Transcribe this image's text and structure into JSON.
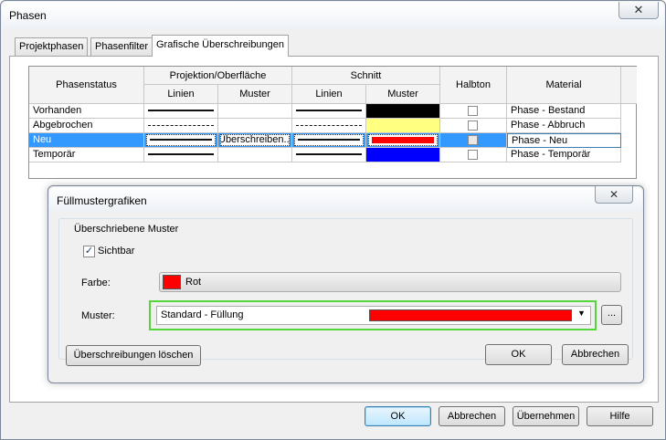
{
  "window": {
    "title": "Phasen",
    "close_glyph": "✕"
  },
  "tabs": [
    {
      "label": "Projektphasen",
      "active": false
    },
    {
      "label": "Phasenfilter",
      "active": false
    },
    {
      "label": "Grafische Überschreibungen",
      "active": true
    }
  ],
  "table": {
    "headers": {
      "phasenstatus": "Phasenstatus",
      "projektion": "Projektion/Oberfläche",
      "schnitt": "Schnitt",
      "halbton": "Halbton",
      "material": "Material",
      "linien_1": "Linien",
      "muster_1": "Muster",
      "linien_2": "Linien",
      "muster_2": "Muster"
    },
    "rows": [
      {
        "status": "Vorhanden",
        "proj_line": "solid",
        "proj_pattern": "",
        "cut_line": "solid",
        "cut_color": "#000000",
        "material": "Phase - Bestand",
        "selected": false
      },
      {
        "status": "Abgebrochen",
        "proj_line": "dashed",
        "proj_pattern": "",
        "cut_line": "dashed",
        "cut_color": "#ffff80",
        "material": "Phase - Abbruch",
        "selected": false
      },
      {
        "status": "Neu",
        "proj_line": "solid",
        "proj_pattern": "Überschreiben...",
        "cut_line": "solid",
        "cut_color": "#ff0000",
        "material": "Phase - Neu",
        "selected": true
      },
      {
        "status": "Temporär",
        "proj_line": "solid",
        "proj_pattern": "",
        "cut_line": "solid",
        "cut_color": "#0000ff",
        "material": "Phase - Temporär",
        "selected": false
      }
    ]
  },
  "subdialog": {
    "title": "Füllmustergrafiken",
    "close_glyph": "✕",
    "group_label": "Überschriebene Muster",
    "visible_label": "Sichtbar",
    "visible_checked": true,
    "color_label": "Farbe:",
    "color_value": "Rot",
    "color_hex": "#ff0000",
    "pattern_label": "Muster:",
    "pattern_value": "Standard - Füllung",
    "pattern_color_hex": "#ff0000",
    "browse_label": "...",
    "clear_button": "Überschreibungen löschen",
    "ok_button": "OK",
    "cancel_button": "Abbrechen"
  },
  "footer": {
    "ok": "OK",
    "cancel": "Abbrechen",
    "apply": "Übernehmen",
    "help": "Hilfe"
  },
  "colors": {
    "selection": "#3399ff",
    "highlight_border": "#55d43b",
    "accent_blue": "#3c7fb1"
  }
}
